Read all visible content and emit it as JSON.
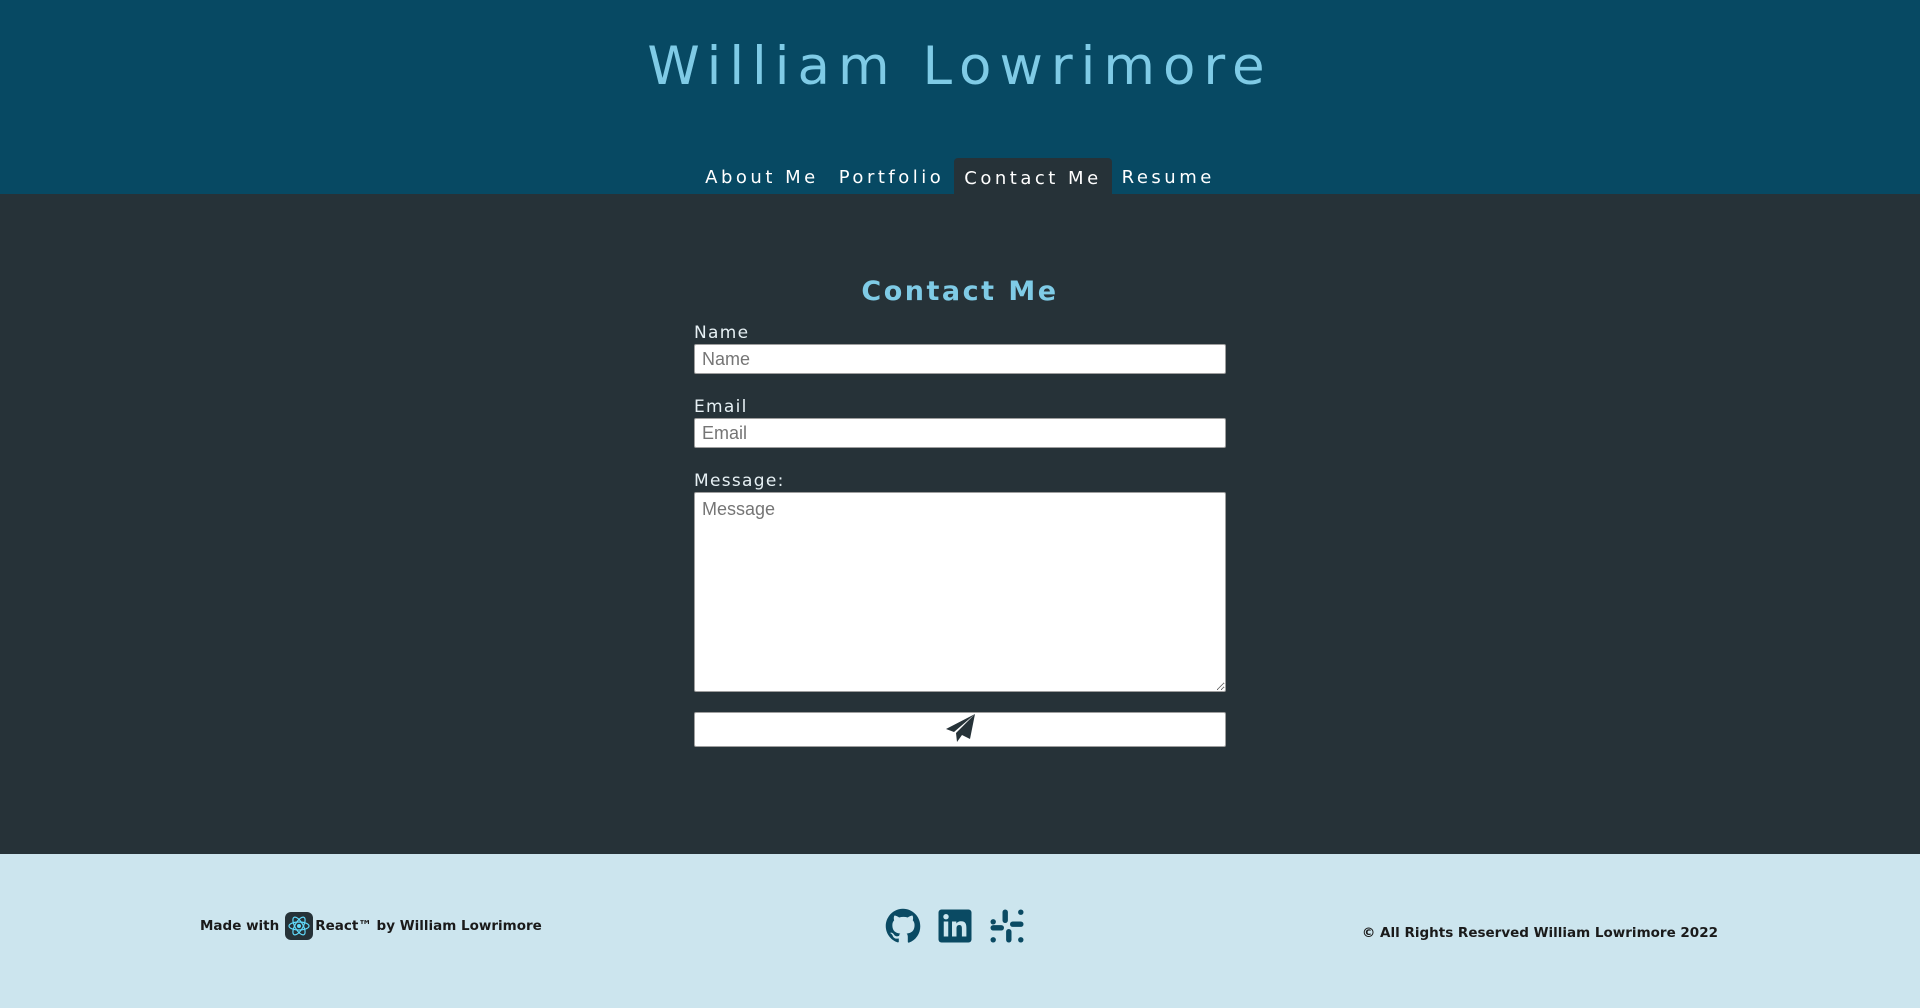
{
  "header": {
    "title": "William Lowrimore",
    "nav": [
      "About Me",
      "Portfolio",
      "Contact Me",
      "Resume"
    ],
    "active_tab": "Contact Me"
  },
  "contact_form": {
    "heading": "Contact Me",
    "name_label": "Name",
    "name_placeholder": "Name",
    "email_label": "Email",
    "email_placeholder": "Email",
    "message_label": "Message:",
    "message_placeholder": "Message",
    "submit_icon": "paper-plane-icon"
  },
  "footer": {
    "made_with_prefix": "Made with",
    "made_with_suffix": "React™ by William Lowrimore",
    "react_icon": "react-icon",
    "social_icons": [
      "github-icon",
      "linkedin-icon",
      "slack-icon"
    ],
    "copyright": "© All Rights Reserved William Lowrimore 2022"
  },
  "colors": {
    "header_bg": "#074963",
    "title": "#7fcbe6",
    "main_bg": "#263238",
    "footer_bg": "#cce5ee",
    "icon": "#0a4a63"
  }
}
